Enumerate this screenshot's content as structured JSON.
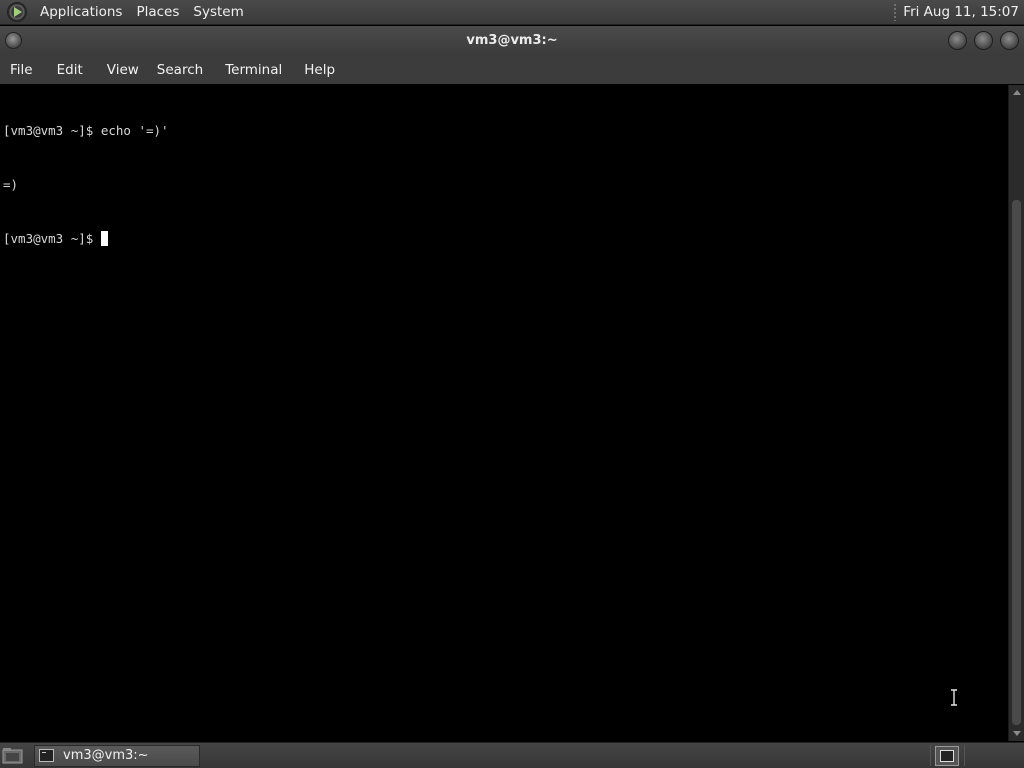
{
  "top_panel": {
    "menus": [
      "Applications",
      "Places",
      "System"
    ],
    "clock": "Fri Aug 11, 15:07"
  },
  "window": {
    "title": "vm3@vm3:~"
  },
  "menubar": {
    "items": [
      "File",
      "Edit",
      "View",
      "Search",
      "Terminal",
      "Help"
    ]
  },
  "terminal": {
    "lines": [
      "[vm3@vm3 ~]$ echo '=)'",
      "=)",
      "[vm3@vm3 ~]$"
    ],
    "background": "#000000",
    "foreground": "#d8d8d8"
  },
  "taskbar": {
    "tasks": [
      {
        "label": "vm3@vm3:~",
        "icon": "terminal-icon"
      }
    ]
  },
  "icons": {
    "distro_logo": "distro-logo-icon",
    "show_desktop": "show-desktop-icon",
    "workspace": "workspace-switcher-icon",
    "mouse_cursor": "ibeam-cursor-icon"
  }
}
